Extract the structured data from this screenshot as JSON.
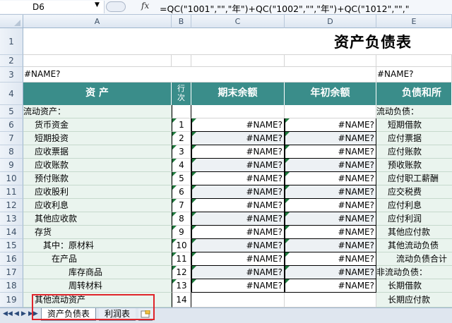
{
  "formula_bar": {
    "cell_ref": "D6",
    "fx_label": "fx",
    "formula": "=QC(\"1001\",\"\",\"年\")+QC(\"1002\",\"\",\"年\")+QC(\"1012\",\"\",\""
  },
  "columns": [
    "A",
    "B",
    "C",
    "D",
    "E"
  ],
  "rows": [
    "1",
    "2",
    "3",
    "4",
    "5",
    "6",
    "7",
    "8",
    "9",
    "10",
    "11",
    "12",
    "13",
    "14",
    "15",
    "16",
    "17",
    "18",
    "19"
  ],
  "title": "资产负债表",
  "name_error": "#NAME?",
  "headers": {
    "assets": "资    产",
    "line_top": "行",
    "line_bottom": "次",
    "end_balance": "期末余额",
    "begin_balance": "年初余额",
    "liabilities": "负债和所"
  },
  "asset_items": [
    {
      "label": "流动资产：",
      "line": ""
    },
    {
      "label": "货币资金",
      "line": "1"
    },
    {
      "label": "短期投资",
      "line": "2"
    },
    {
      "label": "应收票据",
      "line": "3"
    },
    {
      "label": "应收账款",
      "line": "4"
    },
    {
      "label": "预付账款",
      "line": "5"
    },
    {
      "label": "应收股利",
      "line": "6"
    },
    {
      "label": "应收利息",
      "line": "7"
    },
    {
      "label": "其他应收款",
      "line": "8"
    },
    {
      "label": "存货",
      "line": "9"
    },
    {
      "label": "其中：原材料",
      "line": "10"
    },
    {
      "label": "在产品",
      "line": "11"
    },
    {
      "label": "库存商品",
      "line": "12"
    },
    {
      "label": "周转材料",
      "line": "13"
    },
    {
      "label": "其他流动资产",
      "line": "14"
    }
  ],
  "liability_items": [
    "流动负债：",
    "短期借款",
    "应付票据",
    "应付账款",
    "预收账款",
    "应付职工薪酬",
    "应交税费",
    "应付利息",
    "应付利润",
    "其他应付款",
    "其他流动负债",
    "流动负债合计",
    "非流动负债：",
    "长期借款",
    "长期应付款"
  ],
  "sheet_tabs": [
    "资产负债表",
    "利润表"
  ],
  "colors": {
    "header_teal": "#3a8d8a",
    "asset_fill": "#eaf4ee",
    "highlight": "#e0242a"
  }
}
